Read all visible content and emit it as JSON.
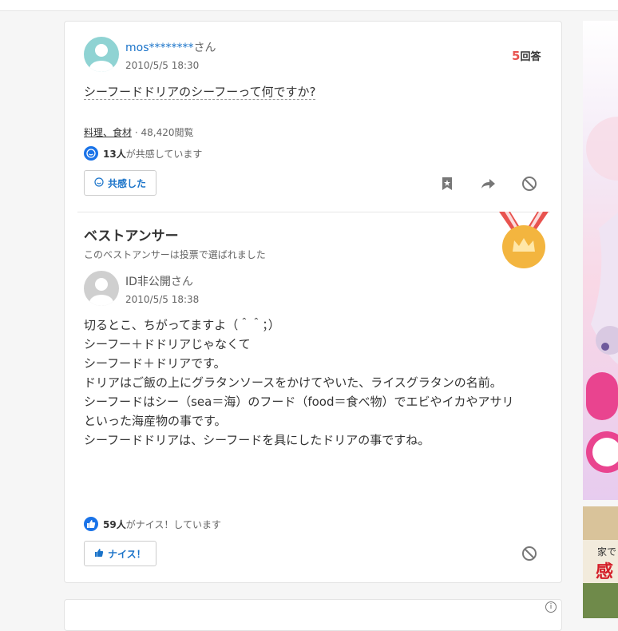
{
  "question": {
    "user_name": "mos********",
    "user_suffix": "さん",
    "date": "2010/5/5 18:30",
    "answer_count_num": "5",
    "answer_count_label": "回答",
    "text": "シーフードドリアのシーフーって何ですか?",
    "category": "料理、食材",
    "views": "48,420閲覧",
    "empathy_count": "13人",
    "empathy_text": "が共感しています",
    "empathy_button": "共感した"
  },
  "best_answer": {
    "title": "ベストアンサー",
    "subtitle": "このベストアンサーは投票で選ばれました",
    "user_name": "ID非公開",
    "user_suffix": "さん",
    "date": "2010/5/5 18:38",
    "lines": [
      "切るとこ、ちがってますよ（＾＾；）",
      "",
      "シーフー＋ドドリアじゃなくて",
      "シーフード＋ドリアです。",
      "",
      "ドリアはご飯の上にグラタンソースをかけてやいた、ライスグラタンの名前。",
      "シーフードはシー（sea＝海）のフード（food＝食べ物）でエビやイカやアサリ",
      "といった海産物の事です。",
      "",
      "シーフードドリアは、シーフードを具にしたドリアの事ですね。"
    ],
    "nice_count": "59人",
    "nice_text": "がナイス！しています",
    "nice_button": "ナイス！"
  },
  "ads": {
    "side_text_1": "家で",
    "side_text_2": "感"
  },
  "colors": {
    "link_blue": "#1a73c9",
    "accent_red": "#e8534f",
    "icon_blue": "#1a73e8",
    "medal_gold": "#f3b53f"
  }
}
